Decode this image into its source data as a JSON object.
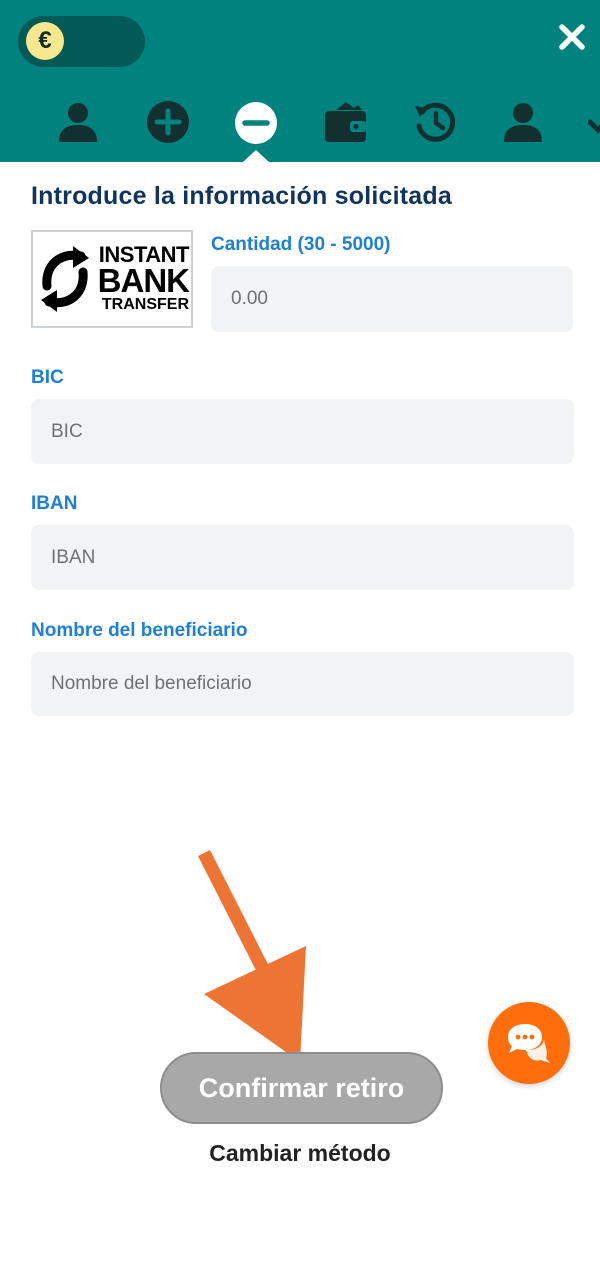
{
  "header": {
    "currency_symbol": "€",
    "close_label": "✕",
    "nav_icons": [
      "user-icon",
      "plus-circle-icon",
      "minus-circle-icon",
      "wallet-icon",
      "history-icon",
      "user-icon",
      "chevron-down-icon"
    ],
    "active_tab": "minus-circle-icon",
    "brand_color": "#00827e"
  },
  "form": {
    "title": "Introduce la información solicitada",
    "logo": {
      "line1": "INSTANT",
      "line2": "BANK",
      "line3": "TRANSFER"
    },
    "amount": {
      "label": "Cantidad (30 - 5000)",
      "placeholder": "0.00",
      "value": ""
    },
    "bic": {
      "label": "BIC",
      "placeholder": "BIC",
      "value": ""
    },
    "iban": {
      "label": "IBAN",
      "placeholder": "IBAN",
      "value": ""
    },
    "beneficiary": {
      "label": "Nombre del beneficiario",
      "placeholder": "Nombre del beneficiario",
      "value": ""
    }
  },
  "actions": {
    "confirm_label": "Confirmar retiro",
    "change_method_label": "Cambiar método"
  },
  "colors": {
    "label_blue": "#1c7fd8",
    "title_navy": "#10345f",
    "chat_orange": "#ff6e0b",
    "annotation_arrow": "#ee7433"
  }
}
